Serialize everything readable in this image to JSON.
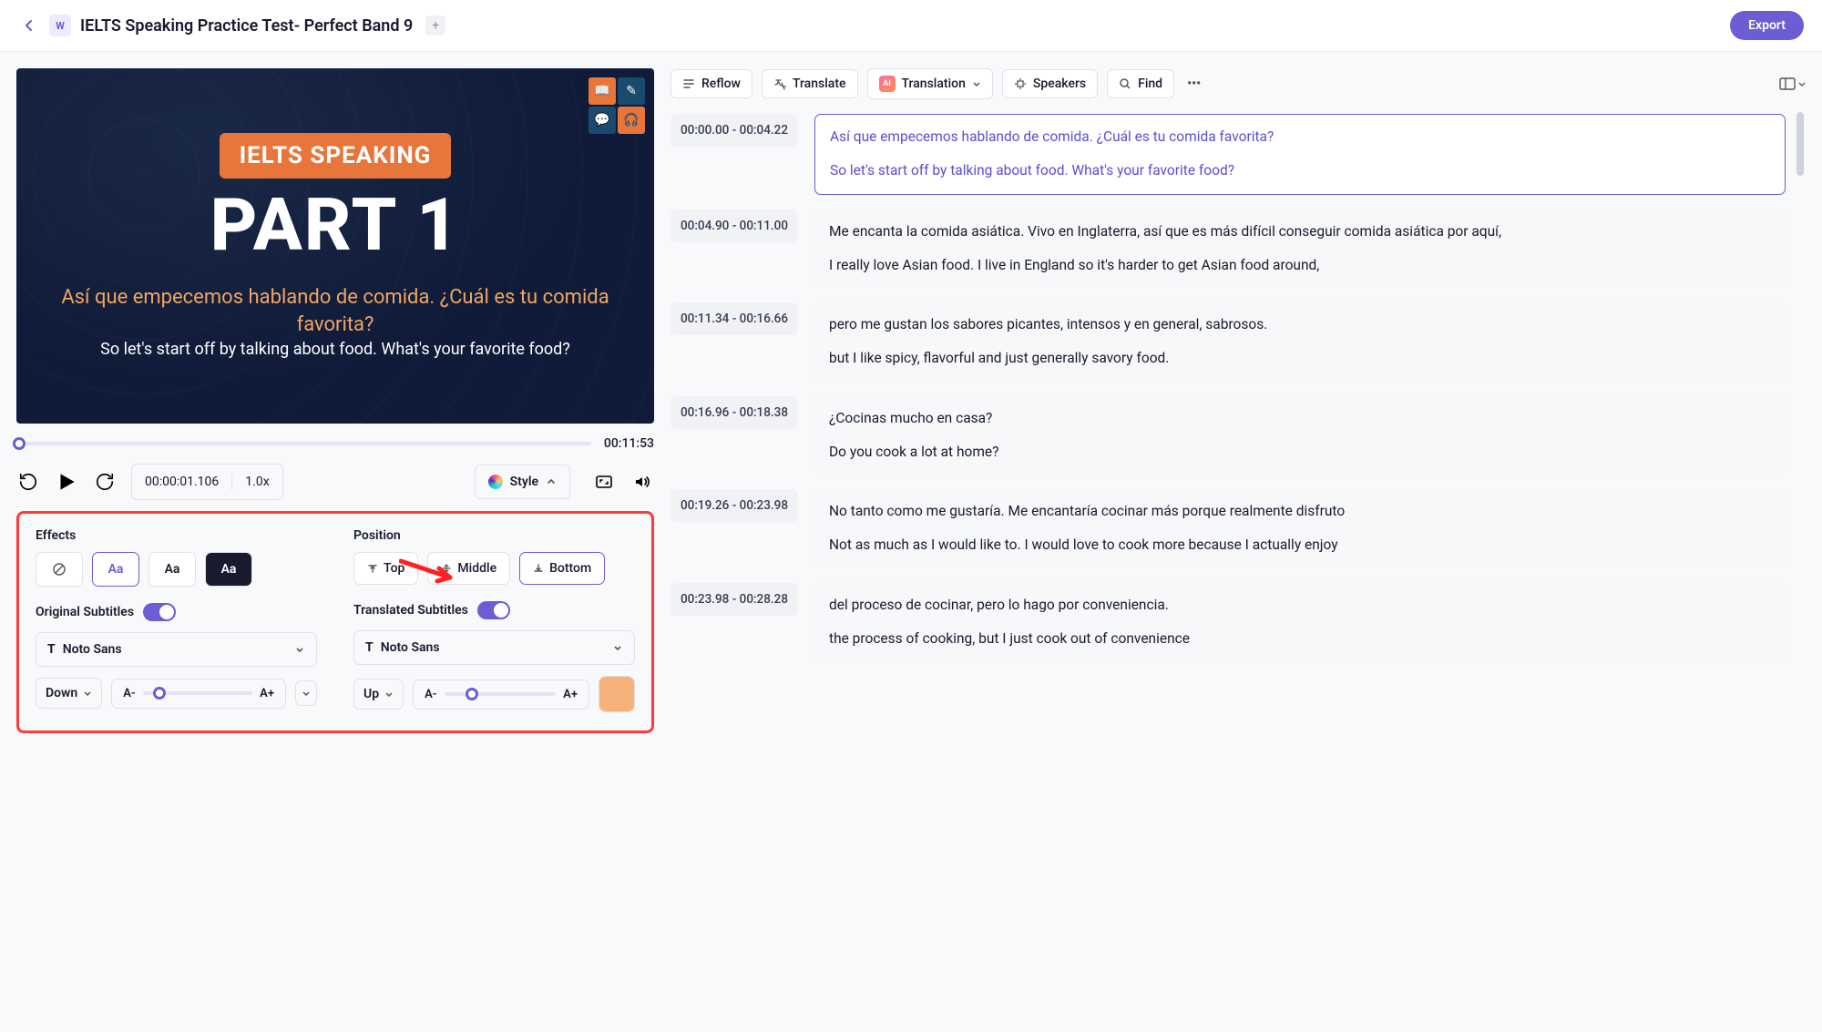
{
  "header": {
    "title": "IELTS Speaking Practice Test- Perfect Band 9",
    "export_label": "Export"
  },
  "video": {
    "badge": "IELTS SPEAKING",
    "part": "PART 1",
    "subtitle_es": "Así que empecemos hablando de comida. ¿Cuál es tu comida favorita?",
    "subtitle_en": "So let's start off by talking about food. What's your favorite food?",
    "total_time": "00:11:53",
    "current_time": "00:00:01.106",
    "speed": "1.0x"
  },
  "style_btn": "Style",
  "style_panel": {
    "effects_label": "Effects",
    "position_label": "Position",
    "pos_top": "Top",
    "pos_middle": "Middle",
    "pos_bottom": "Bottom",
    "orig_subs_label": "Original Subtitles",
    "trans_subs_label": "Translated Subtitles",
    "font_orig": "Noto Sans",
    "font_trans": "Noto Sans",
    "dir_orig": "Down",
    "dir_trans": "Up",
    "size_minus": "A-",
    "size_plus": "A+",
    "color_trans": "#f6b27a"
  },
  "toolbar": {
    "reflow": "Reflow",
    "translate": "Translate",
    "translation": "Translation",
    "speakers": "Speakers",
    "find": "Find"
  },
  "segments": [
    {
      "time": "00:00.00 - 00:04.22",
      "es": "Así que empecemos hablando de comida. ¿Cuál es tu comida favorita?",
      "en": "So let's start off by talking about food. What's your favorite food?",
      "active": true
    },
    {
      "time": "00:04.90 - 00:11.00",
      "es": "Me encanta la comida asiática. Vivo en Inglaterra, así que es más difícil conseguir comida asiática por aquí,",
      "en": "I really love Asian food. I live in England so it's harder to get Asian food around,"
    },
    {
      "time": "00:11.34 - 00:16.66",
      "es": "pero me gustan los sabores picantes, intensos y en general, sabrosos.",
      "en": "but I like spicy, flavorful and just generally savory food."
    },
    {
      "time": "00:16.96 - 00:18.38",
      "es": "¿Cocinas mucho en casa?",
      "en": "Do you cook a lot at home?"
    },
    {
      "time": "00:19.26 - 00:23.98",
      "es": "No tanto como me gustaría. Me encantaría cocinar más porque realmente disfruto",
      "en": "Not as much as I would like to. I would love to cook more because I actually enjoy"
    },
    {
      "time": "00:23.98 - 00:28.28",
      "es": "del proceso de cocinar, pero lo hago por conveniencia.",
      "en": "the process of cooking, but I just cook out of convenience"
    }
  ]
}
